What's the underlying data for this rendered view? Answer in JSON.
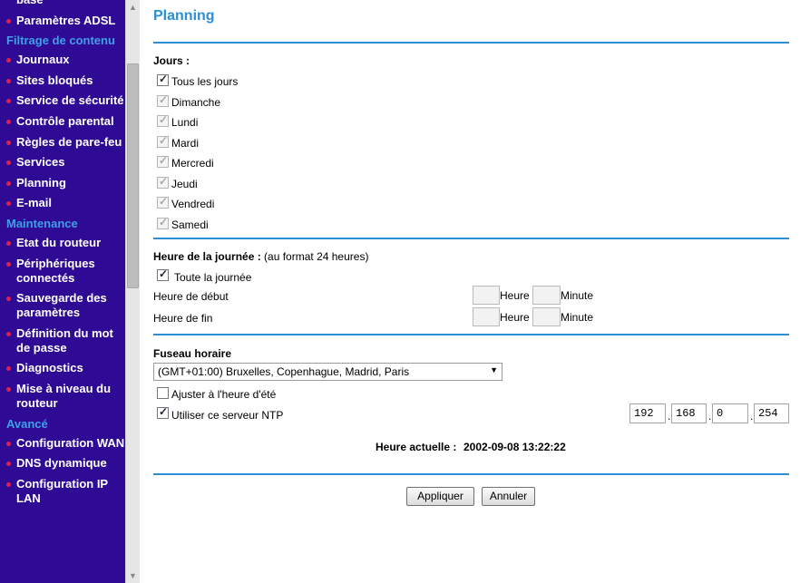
{
  "sidebar": {
    "items": [
      {
        "type": "item",
        "label": "base",
        "bullet": false
      },
      {
        "type": "item",
        "label": "Paramètres ADSL",
        "bullet": true
      },
      {
        "type": "section",
        "label": "Filtrage de contenu"
      },
      {
        "type": "item",
        "label": "Journaux",
        "bullet": true
      },
      {
        "type": "item",
        "label": "Sites bloqués",
        "bullet": true
      },
      {
        "type": "item",
        "label": "Service de sécurité",
        "bullet": true
      },
      {
        "type": "item",
        "label": "Contrôle parental",
        "bullet": true
      },
      {
        "type": "item",
        "label": "Règles de pare-feu",
        "bullet": true
      },
      {
        "type": "item",
        "label": "Services",
        "bullet": true
      },
      {
        "type": "item",
        "label": "Planning",
        "bullet": true
      },
      {
        "type": "item",
        "label": "E-mail",
        "bullet": true
      },
      {
        "type": "section",
        "label": "Maintenance"
      },
      {
        "type": "item",
        "label": "Etat du routeur",
        "bullet": true
      },
      {
        "type": "item",
        "label": "Périphériques connectés",
        "bullet": true
      },
      {
        "type": "item",
        "label": "Sauvegarde des paramètres",
        "bullet": true
      },
      {
        "type": "item",
        "label": "Définition du mot de passe",
        "bullet": true
      },
      {
        "type": "item",
        "label": "Diagnostics",
        "bullet": true
      },
      {
        "type": "item",
        "label": "Mise à niveau du routeur",
        "bullet": true
      },
      {
        "type": "section",
        "label": "Avancé"
      },
      {
        "type": "item",
        "label": "Configuration WAN",
        "bullet": true
      },
      {
        "type": "item",
        "label": "DNS dynamique",
        "bullet": true
      },
      {
        "type": "item",
        "label": "Configuration IP LAN",
        "bullet": true
      }
    ]
  },
  "page": {
    "title": "Planning"
  },
  "days": {
    "label": "Jours :",
    "items": [
      {
        "label": "Tous les jours",
        "checked": true,
        "disabled": false
      },
      {
        "label": "Dimanche",
        "checked": true,
        "disabled": true
      },
      {
        "label": "Lundi",
        "checked": true,
        "disabled": true
      },
      {
        "label": "Mardi",
        "checked": true,
        "disabled": true
      },
      {
        "label": "Mercredi",
        "checked": true,
        "disabled": true
      },
      {
        "label": "Jeudi",
        "checked": true,
        "disabled": true
      },
      {
        "label": "Vendredi",
        "checked": true,
        "disabled": true
      },
      {
        "label": "Samedi",
        "checked": true,
        "disabled": true
      }
    ]
  },
  "time": {
    "label_bold": "Heure de la journée :",
    "label_note": "(au format 24 heures)",
    "all_day_label": "Toute la journée",
    "all_day_checked": true,
    "start_label": "Heure de début",
    "end_label": "Heure de fin",
    "hour_label": "Heure",
    "minute_label": "Minute",
    "start_hour": "",
    "start_minute": "",
    "end_hour": "",
    "end_minute": ""
  },
  "timezone": {
    "label": "Fuseau horaire",
    "selected": "(GMT+01:00) Bruxelles, Copenhague, Madrid, Paris",
    "dst_label": "Ajuster à l'heure d'été",
    "dst_checked": false,
    "ntp_label": "Utiliser ce serveur NTP",
    "ntp_checked": true,
    "ntp_ip": [
      "192",
      "168",
      "0",
      "254"
    ],
    "ip_separator": ".",
    "current_label": "Heure actuelle :",
    "current_value": "2002-09-08 13:22:22"
  },
  "buttons": {
    "apply": "Appliquer",
    "cancel": "Annuler"
  },
  "colors": {
    "sidebar_bg": "#2f0b95",
    "section_text": "#3fa0e8",
    "bullet": "#e0204a",
    "title": "#2a8fd4",
    "rule": "#2a8fd4"
  }
}
